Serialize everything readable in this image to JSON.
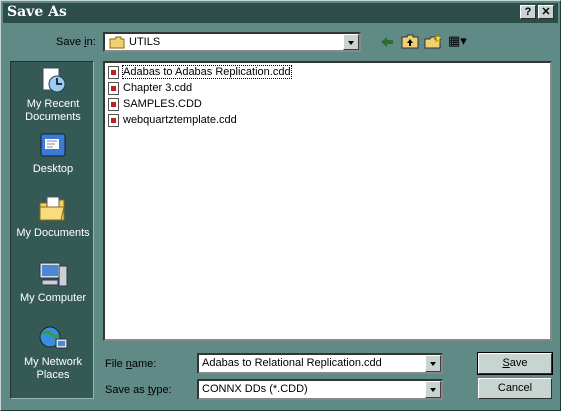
{
  "window": {
    "title": "Save As",
    "help_button": "?",
    "close_button": "✕"
  },
  "save_in": {
    "label_pre": "Save ",
    "label_ul": "i",
    "label_post": "n:",
    "value": "UTILS"
  },
  "toolbar": {
    "views_label": "▦▾"
  },
  "places": [
    {
      "name": "recent",
      "label_line1": "My Recent",
      "label_line2": "Documents"
    },
    {
      "name": "desktop",
      "label_line1": "Desktop",
      "label_line2": ""
    },
    {
      "name": "documents",
      "label_line1": "My Documents",
      "label_line2": ""
    },
    {
      "name": "computer",
      "label_line1": "My Computer",
      "label_line2": ""
    },
    {
      "name": "network",
      "label_line1": "My Network",
      "label_line2": "Places"
    }
  ],
  "files": [
    "Adabas to Adabas Replication.cdd",
    "Chapter 3.cdd",
    "SAMPLES.CDD",
    "webquartztemplate.cdd"
  ],
  "file_name": {
    "label_pre": "File ",
    "label_ul": "n",
    "label_post": "ame:",
    "value": "Adabas to Relational Replication.cdd"
  },
  "save_as_type": {
    "label_pre": "Save as ",
    "label_ul": "t",
    "label_post": "ype:",
    "value": "CONNX DDs (*.CDD)"
  },
  "buttons": {
    "save_ul": "S",
    "save_rest": "ave",
    "cancel": "Cancel"
  }
}
